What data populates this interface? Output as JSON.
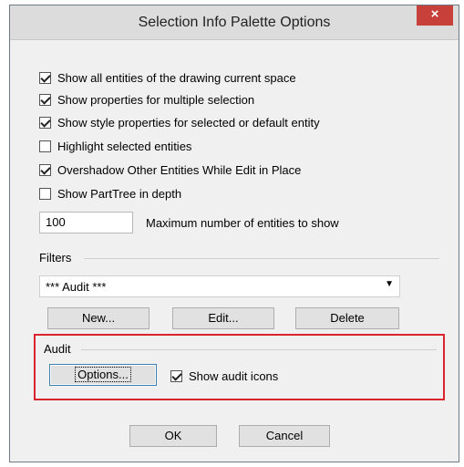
{
  "window": {
    "title": "Selection Info Palette Options",
    "close_glyph": "×"
  },
  "checkboxes": [
    {
      "label": "Show all entities of the drawing current space",
      "checked": true
    },
    {
      "label": "Show properties for multiple selection",
      "checked": true
    },
    {
      "label": "Show style properties for selected or default entity",
      "checked": true
    },
    {
      "label": "Highlight selected entities",
      "checked": false
    },
    {
      "label": "Overshadow Other Entities While Edit in Place",
      "checked": true
    },
    {
      "label": "Show PartTree in depth",
      "checked": false
    }
  ],
  "max_entities": {
    "value": "100",
    "label": "Maximum number of entities to show"
  },
  "filters": {
    "group_label": "Filters",
    "selected": "*** Audit ***",
    "buttons": {
      "new": "New...",
      "edit": "Edit...",
      "delete": "Delete"
    }
  },
  "audit": {
    "group_label": "Audit",
    "options_button": "Options...",
    "show_icons_label": "Show audit icons",
    "show_icons_checked": true
  },
  "dialog_buttons": {
    "ok": "OK",
    "cancel": "Cancel"
  },
  "colors": {
    "highlight_box": "#d9232d",
    "close_button": "#c7403a"
  }
}
